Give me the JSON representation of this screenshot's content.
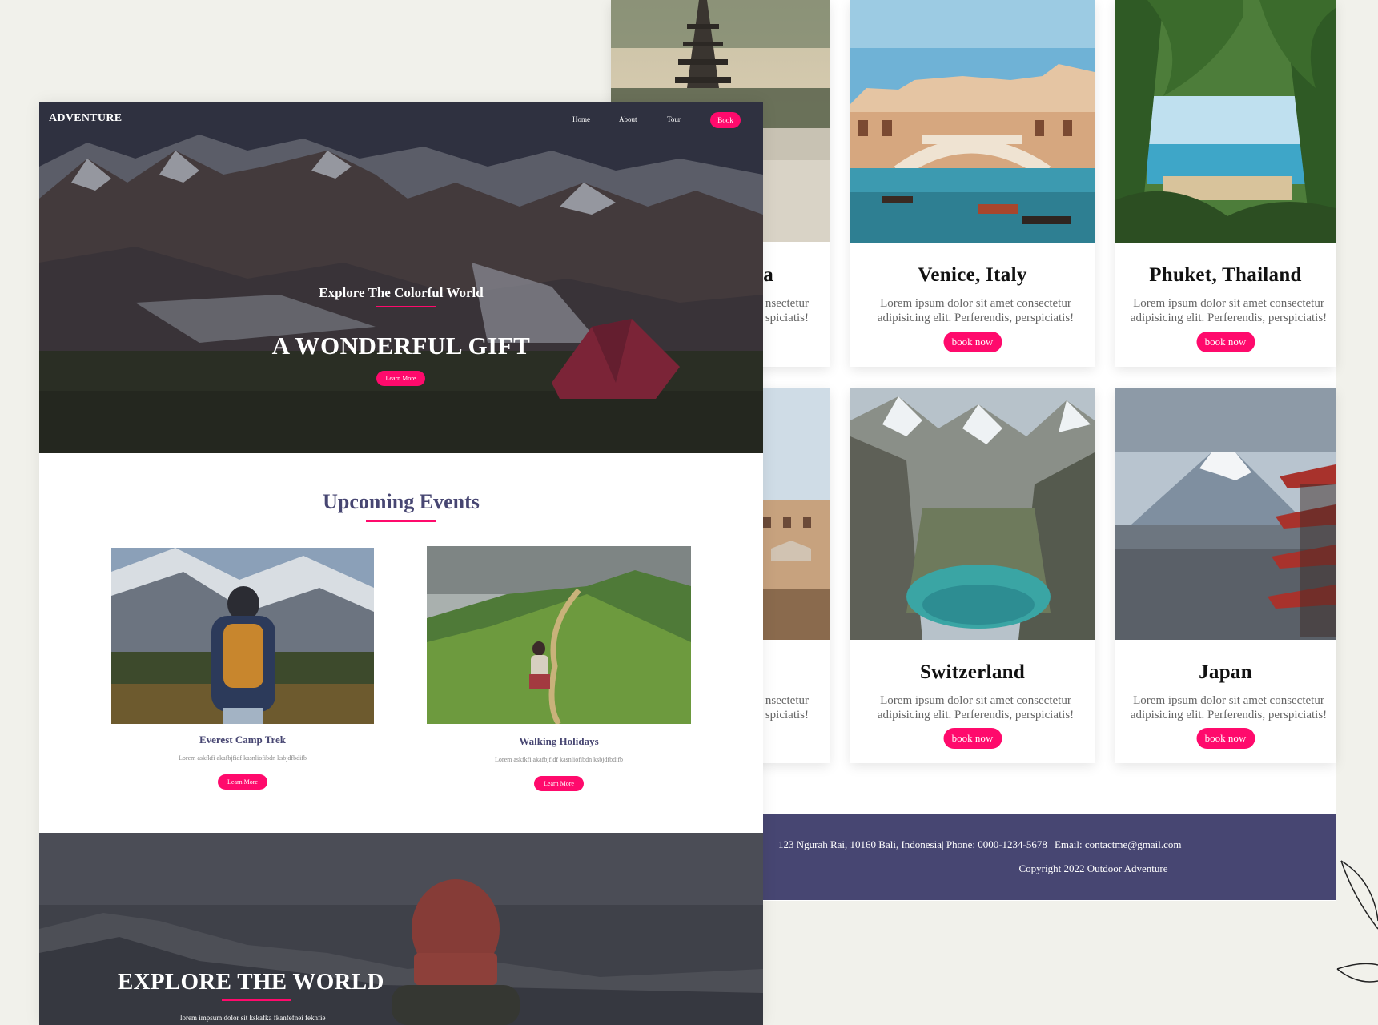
{
  "colors": {
    "accent": "#ff0a6c",
    "brand_navy": "#474672",
    "page_background": "#f1f1eb"
  },
  "destinations": [
    {
      "name": "Venice, Italy",
      "description_line1": "Lorem ipsum dolor sit amet consectetur",
      "description_line2": "adipisicing elit. Perferendis, perspiciatis!",
      "button": "book now"
    },
    {
      "name": "Phuket, Thailand",
      "description_line1": "Lorem ipsum dolor sit amet consectetur",
      "description_line2": "adipisicing elit. Perferendis, perspiciatis!",
      "button": "book now"
    },
    {
      "name": "Switzerland",
      "description_line1": "Lorem ipsum dolor sit amet consectetur",
      "description_line2": "adipisicing elit. Perferendis, perspiciatis!",
      "button": "book now"
    },
    {
      "name": "Japan",
      "description_line1": "Lorem ipsum dolor sit amet consectetur",
      "description_line2": "adipisicing elit. Perferendis, perspiciatis!",
      "button": "book now"
    }
  ],
  "partial_cards": [
    {
      "name_tail": "a",
      "description_line1_tail": "nsectetur",
      "description_line2_tail": "spiciatis!"
    },
    {
      "description_line1_tail": "nsectetur",
      "description_line2_tail": "spiciatis!"
    }
  ],
  "footer": {
    "address": "123 Ngurah Rai, 10160 Bali, Indonesia| Phone: 0000-1234-5678 | Email: contactme@gmail.com",
    "copyright": "Copyright 2022 Outdoor Adventure"
  },
  "header": {
    "brand": "ADVENTURE",
    "nav": {
      "home": "Home",
      "about": "About",
      "tour": "Tour",
      "book": "Book"
    }
  },
  "hero": {
    "subtitle": "Explore The Colorful World",
    "title": "A WONDERFUL GIFT",
    "button": "Learn More"
  },
  "events": {
    "title": "Upcoming Events",
    "items": [
      {
        "title": "Everest Camp Trek",
        "description": "Lorem askfkfi akafbjfidf kasnliofibdn ksbjdfbdifb",
        "button": "Learn More"
      },
      {
        "title": "Walking Holidays",
        "description": "Lorem askfkfi akafbjfidf kasnliofibdn ksbjdfbdifb",
        "button": "Learn More"
      }
    ]
  },
  "explore": {
    "title": "EXPLORE THE WORLD",
    "text": "lorem impsum dolor sit kskafka fkanfefnei feknfie"
  }
}
